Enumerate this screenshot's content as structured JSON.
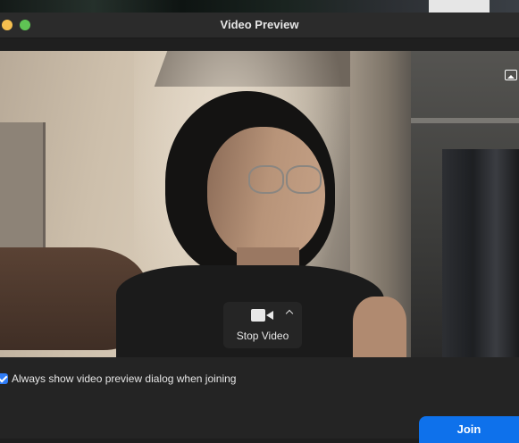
{
  "window": {
    "title": "Video Preview"
  },
  "video": {
    "stop_video_label": "Stop Video",
    "camera_icon": "video-camera-icon",
    "options_icon": "chevron-up-icon",
    "background_icon": "photo-icon"
  },
  "preferences": {
    "always_show_preview_label": "Always show video preview dialog when joining",
    "always_show_preview_checked": true
  },
  "actions": {
    "join_label": "Join"
  },
  "colors": {
    "accent": "#0e71eb",
    "checkbox": "#2f7cf6",
    "window_bg": "#242424",
    "title_bg": "#2b2b2b"
  }
}
